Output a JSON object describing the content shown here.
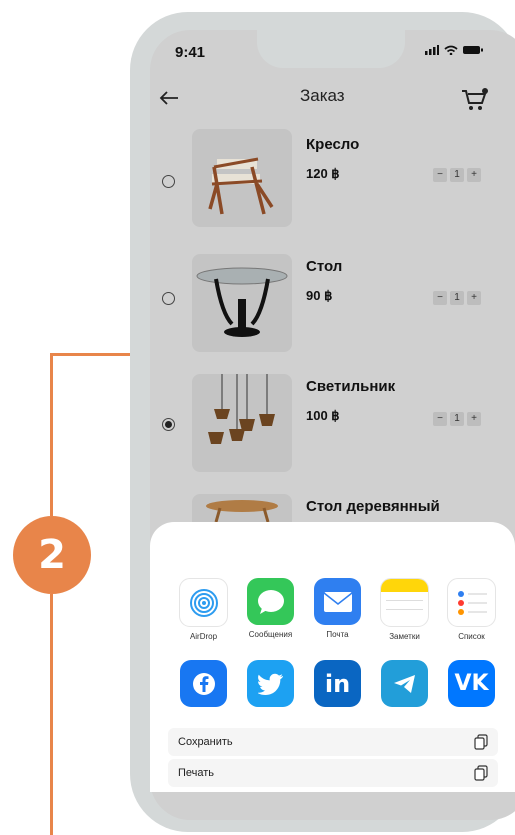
{
  "annotation": {
    "badge": "2",
    "color": "#e8854a"
  },
  "status_bar": {
    "time": "9:41"
  },
  "header": {
    "title": "Заказ",
    "back_icon": "arrow-left-icon",
    "cart_icon": "cart-icon"
  },
  "items": [
    {
      "name": "Кресло",
      "price": "120 ฿",
      "quantity": "1",
      "selected": false
    },
    {
      "name": "Стол",
      "price": "90 ฿",
      "quantity": "1",
      "selected": false
    },
    {
      "name": "Светильник",
      "price": "100 ฿",
      "quantity": "1",
      "selected": true
    },
    {
      "name": "Стол деревянный"
    }
  ],
  "stepper": {
    "minus": "−",
    "plus": "+"
  },
  "share_sheet": {
    "apps": [
      {
        "label": "AirDrop",
        "icon": "airdrop-icon",
        "color": "#ffffff"
      },
      {
        "label": "Сообщения",
        "icon": "messages-icon",
        "color": "#34c759"
      },
      {
        "label": "Почта",
        "icon": "mail-icon",
        "color": "#2f7ff0"
      },
      {
        "label": "Заметки",
        "icon": "notes-icon",
        "color": "#ffffff"
      },
      {
        "label": "Список",
        "icon": "reminders-icon",
        "color": "#ffffff"
      }
    ],
    "social": [
      {
        "icon": "facebook-icon",
        "color": "#1877f2",
        "glyph": "f"
      },
      {
        "icon": "twitter-icon",
        "color": "#1da1f2",
        "glyph": "t"
      },
      {
        "icon": "linkedin-icon",
        "color": "#0a66c2",
        "glyph": "in"
      },
      {
        "icon": "telegram-icon",
        "color": "#229ed9",
        "glyph": "➤"
      },
      {
        "icon": "vk-icon",
        "color": "#0077ff",
        "glyph": "VK"
      }
    ],
    "actions": [
      {
        "label": "Сохранить",
        "icon": "copy-icon"
      },
      {
        "label": "Печать",
        "icon": "copy-icon"
      }
    ]
  }
}
